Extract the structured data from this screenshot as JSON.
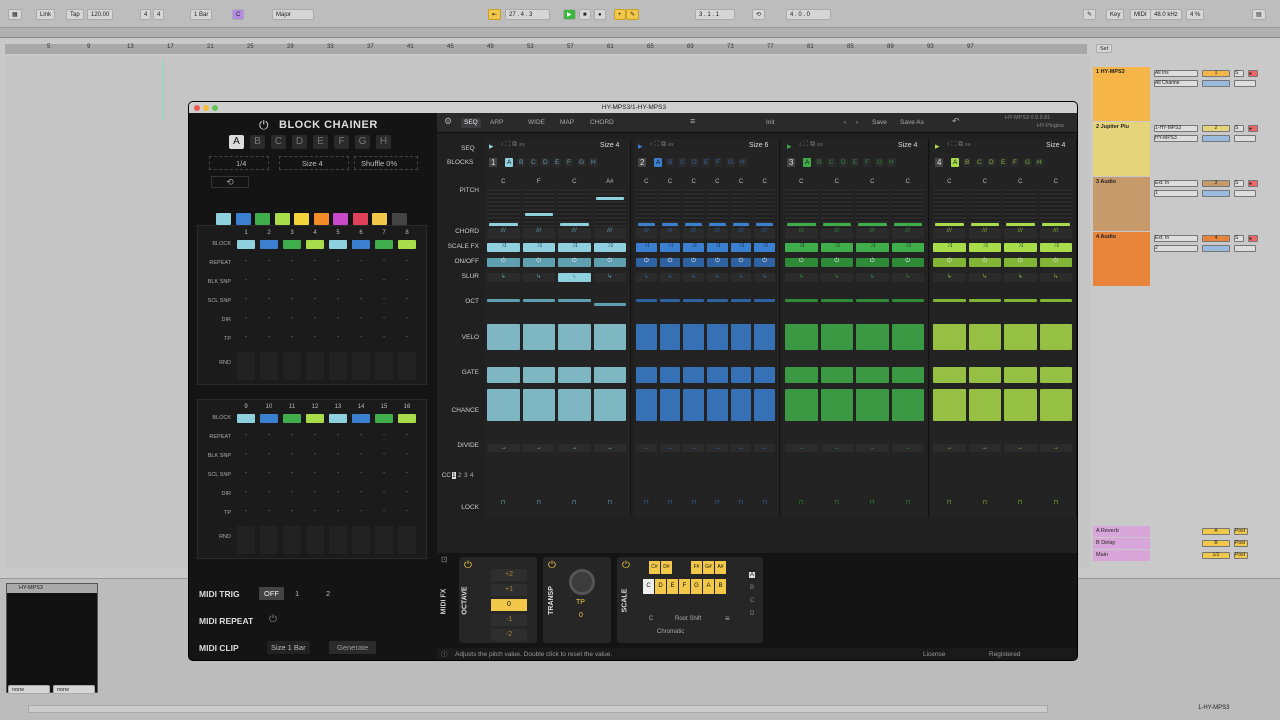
{
  "top": {
    "link": "Link",
    "tap": "Tap",
    "bpm": "120.00",
    "sig_num": "4",
    "sig_den": "4",
    "quant": "1 Bar",
    "key_root": "C",
    "scale": "Major",
    "pos": "27 . 4 . 3",
    "loop_start": "3 . 1 . 1",
    "loop_len": "4 . 0 . 0",
    "key": "Key",
    "midi": "MIDI",
    "rate": "48.0 kHz",
    "cpu": "4 %"
  },
  "ruler": {
    "marks": [
      "5",
      "9",
      "13",
      "17",
      "21",
      "25",
      "29",
      "33",
      "37",
      "41",
      "45",
      "49",
      "53",
      "57",
      "61",
      "65",
      "69",
      "73",
      "77",
      "81",
      "85",
      "89",
      "93",
      "97"
    ],
    "set": "Set"
  },
  "tracks": [
    {
      "name": "1 HY-MPS3",
      "color": "#f5b548",
      "in": "All Ins",
      "ch": "All Channe",
      "num": "1"
    },
    {
      "name": "2 Jupiter Plu",
      "color": "#e6d47a",
      "in": "1-HY-MPS3",
      "ch": "HY-MPS3",
      "num": "2"
    },
    {
      "name": "3 Audio",
      "color": "#c79a6c",
      "in": "Ext. In",
      "ch": "1",
      "num": "3"
    },
    {
      "name": "4 Audio",
      "color": "#e8853a",
      "in": "Ext. In",
      "ch": "2",
      "num": "4"
    }
  ],
  "returns": [
    {
      "name": "A Reverb",
      "letter": "A",
      "post": "Post"
    },
    {
      "name": "B Delay",
      "letter": "B",
      "post": "Post"
    },
    {
      "name": "Main",
      "letter": "1/2",
      "post": "Post"
    }
  ],
  "win": {
    "title": "HY-MPS3/1-HY-MPS3",
    "version": "HY-MPS3 0.9.9.81",
    "brand": "HY-Plugins"
  },
  "left": {
    "title": "BLOCK CHAINER",
    "patterns": [
      "A",
      "B",
      "C",
      "D",
      "E",
      "F",
      "G",
      "H"
    ],
    "div": "1/4",
    "size": "Size 4",
    "shuffle": "Shuffle 0%",
    "rows": [
      "BLOCK",
      "REPEAT",
      "BLK SNP",
      "SCL SNP",
      "DIR",
      "TP",
      "RND"
    ],
    "nums1": [
      "1",
      "2",
      "3",
      "4",
      "5",
      "6",
      "7",
      "8"
    ],
    "nums2": [
      "9",
      "10",
      "11",
      "12",
      "13",
      "14",
      "15",
      "16"
    ],
    "midi_trig": "MIDI TRIG",
    "trig_opts": [
      "OFF",
      "1",
      "2"
    ],
    "midi_repeat": "MIDI REPEAT",
    "midi_clip": "MIDI CLIP",
    "clip_size": "Size 1 Bar",
    "generate": "Generate"
  },
  "tabs": [
    "SEQ",
    "ARP",
    "WIDE",
    "MAP",
    "CHORD"
  ],
  "preset": "Init",
  "save": "Save",
  "saveas": "Save As",
  "seq": {
    "seq_label": "SEQ",
    "blocks_label": "BLOCKS",
    "rows": [
      "PITCH",
      "CHORD",
      "SCALE FX",
      "ON/OFF",
      "SLUR",
      "OCT",
      "VELO",
      "GATE",
      "CHANCE",
      "DIVIDE",
      "CC",
      "LOCK"
    ],
    "cc_opts": [
      "1",
      "2",
      "3",
      "4"
    ],
    "blocks": [
      {
        "num": "1",
        "size": "Size 4",
        "color": "#8ed0de",
        "dark": "#5e9fb0",
        "notes": [
          "C",
          "F",
          "C",
          "A#"
        ]
      },
      {
        "num": "2",
        "size": "Size 6",
        "color": "#3a7fd0",
        "dark": "#2e62a0",
        "notes": [
          "C",
          "C",
          "C",
          "C",
          "C",
          "C"
        ]
      },
      {
        "num": "3",
        "size": "Size 4",
        "color": "#3fae4a",
        "dark": "#2f8a38",
        "notes": [
          "C",
          "C",
          "C",
          "C"
        ]
      },
      {
        "num": "4",
        "size": "Size 4",
        "color": "#a9dc4a",
        "dark": "#82b536",
        "notes": [
          "C",
          "C",
          "C",
          "C"
        ]
      }
    ],
    "letters": [
      "A",
      "B",
      "C",
      "D",
      "E",
      "F",
      "G",
      "H"
    ]
  },
  "fx": {
    "midi_fx": "MIDI FX",
    "octave": "OCTAVE",
    "oct_vals": [
      "+2",
      "+1",
      "0",
      "-1",
      "-2"
    ],
    "transp": "TRANSP",
    "tp": "TP",
    "tp_val": "0",
    "scale": "SCALE",
    "sharps": [
      "C#",
      "D#",
      "F#",
      "G#",
      "A#"
    ],
    "naturals": [
      "C",
      "D",
      "E",
      "F",
      "G",
      "A",
      "B"
    ],
    "root": "C",
    "root_shift": "Root Shift",
    "mode": "Chromatic",
    "abcd": [
      "A",
      "B",
      "C",
      "D"
    ]
  },
  "status": {
    "hint": "Adjusts the pitch value. Double click to reset the value.",
    "license": "License",
    "registered": "Registered"
  },
  "bottom": {
    "device": "HY-MPS3",
    "none1": "none",
    "none2": "none",
    "clip": "1-HY-MPS3"
  }
}
